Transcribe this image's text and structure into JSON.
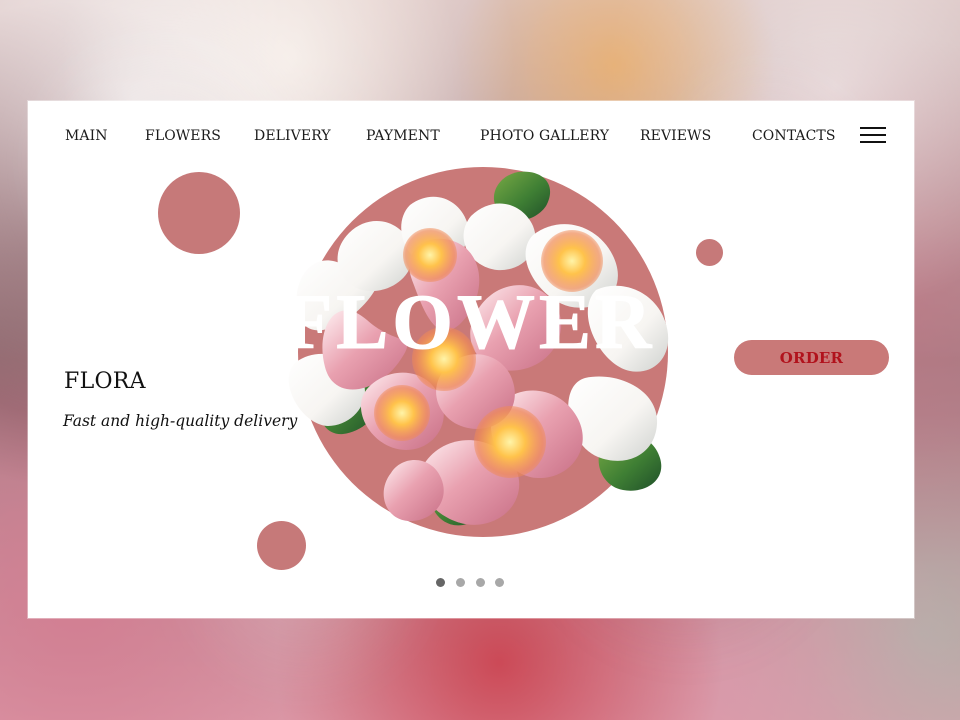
{
  "navigation": {
    "items": [
      {
        "label": "MAIN"
      },
      {
        "label": "FLOWERS"
      },
      {
        "label": "DELIVERY"
      },
      {
        "label": "PAYMENT"
      },
      {
        "label": "PHOTO GALLERY"
      },
      {
        "label": "REVIEWS"
      },
      {
        "label": "CONTACTS"
      }
    ],
    "menu_icon": "hamburger-icon"
  },
  "hero": {
    "brand_title": "FLORA",
    "subtitle": "Fast and high-quality delivery",
    "overlay_word": "FLOWER",
    "cta_label": "ORDER"
  },
  "carousel": {
    "active_slide": 1,
    "slide_count": 4
  },
  "colors": {
    "accent": "#c67979",
    "button_text": "#b1121c",
    "panel_background": "#ffffff",
    "text": "#111111"
  },
  "icons": {
    "menu": "hamburger-icon",
    "hero": "flower-bouquet-icon"
  }
}
